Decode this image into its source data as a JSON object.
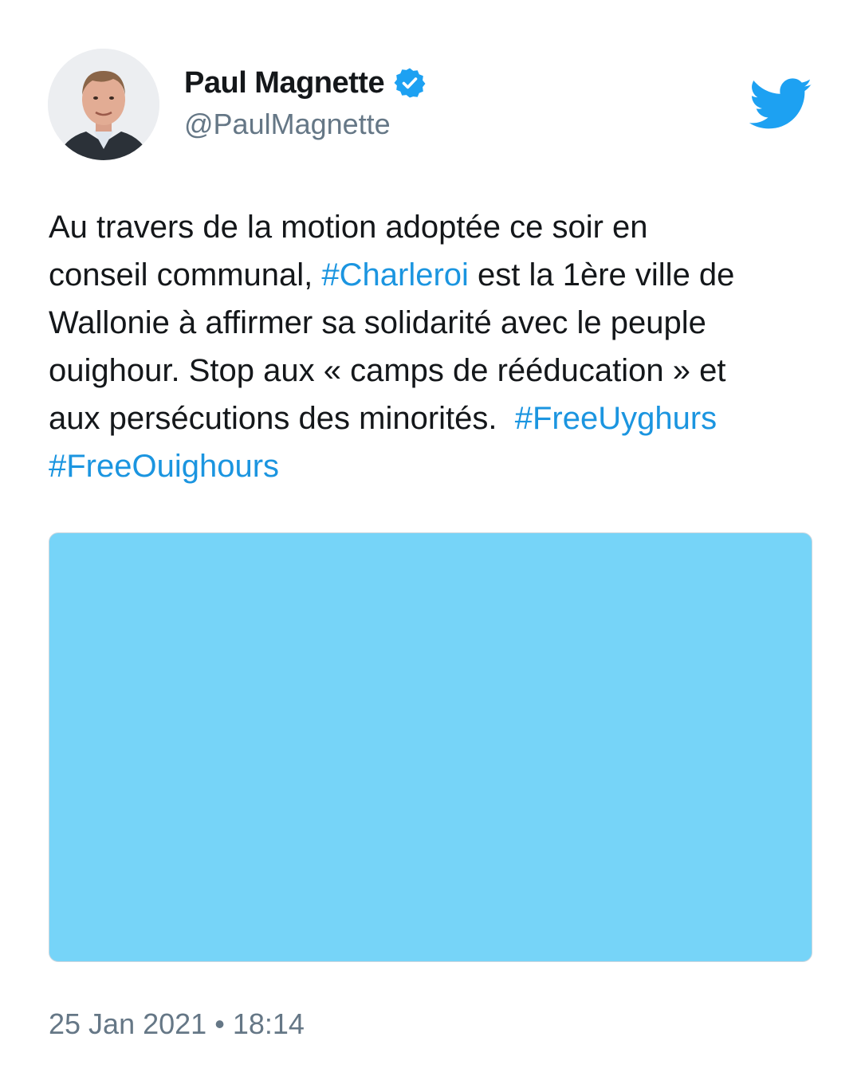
{
  "author": {
    "display_name": "Paul Magnette",
    "handle": "@PaulMagnette",
    "verified": true
  },
  "tweet": {
    "lines": [
      [
        {
          "text": "Au travers de la motion adoptée ce soir en",
          "type": "text"
        }
      ],
      [
        {
          "text": "conseil communal, ",
          "type": "text"
        },
        {
          "text": "#Charleroi",
          "type": "hashtag"
        },
        {
          "text": " est la 1ère ville de",
          "type": "text"
        }
      ],
      [
        {
          "text": "Wallonie à affirmer sa solidarité avec le peuple",
          "type": "text"
        }
      ],
      [
        {
          "text": "ouighour. Stop aux « camps de rééducation » et",
          "type": "text"
        }
      ],
      [
        {
          "text": "aux persécutions des minorités.  ",
          "type": "text"
        },
        {
          "text": "#FreeUyghurs",
          "type": "hashtag"
        }
      ],
      [
        {
          "text": "#FreeOuighours",
          "type": "hashtag"
        }
      ]
    ]
  },
  "timestamp": {
    "date": "25 Jan 2021",
    "separator": "•",
    "time": "18:14"
  },
  "colors": {
    "hashtag": "#1b95e0",
    "twitter_brand": "#1da1f2",
    "media_placeholder": "#76d4f8",
    "muted_text": "#657786"
  },
  "icons": {
    "verified": "verified-badge-icon",
    "brand": "twitter-bird-icon"
  }
}
